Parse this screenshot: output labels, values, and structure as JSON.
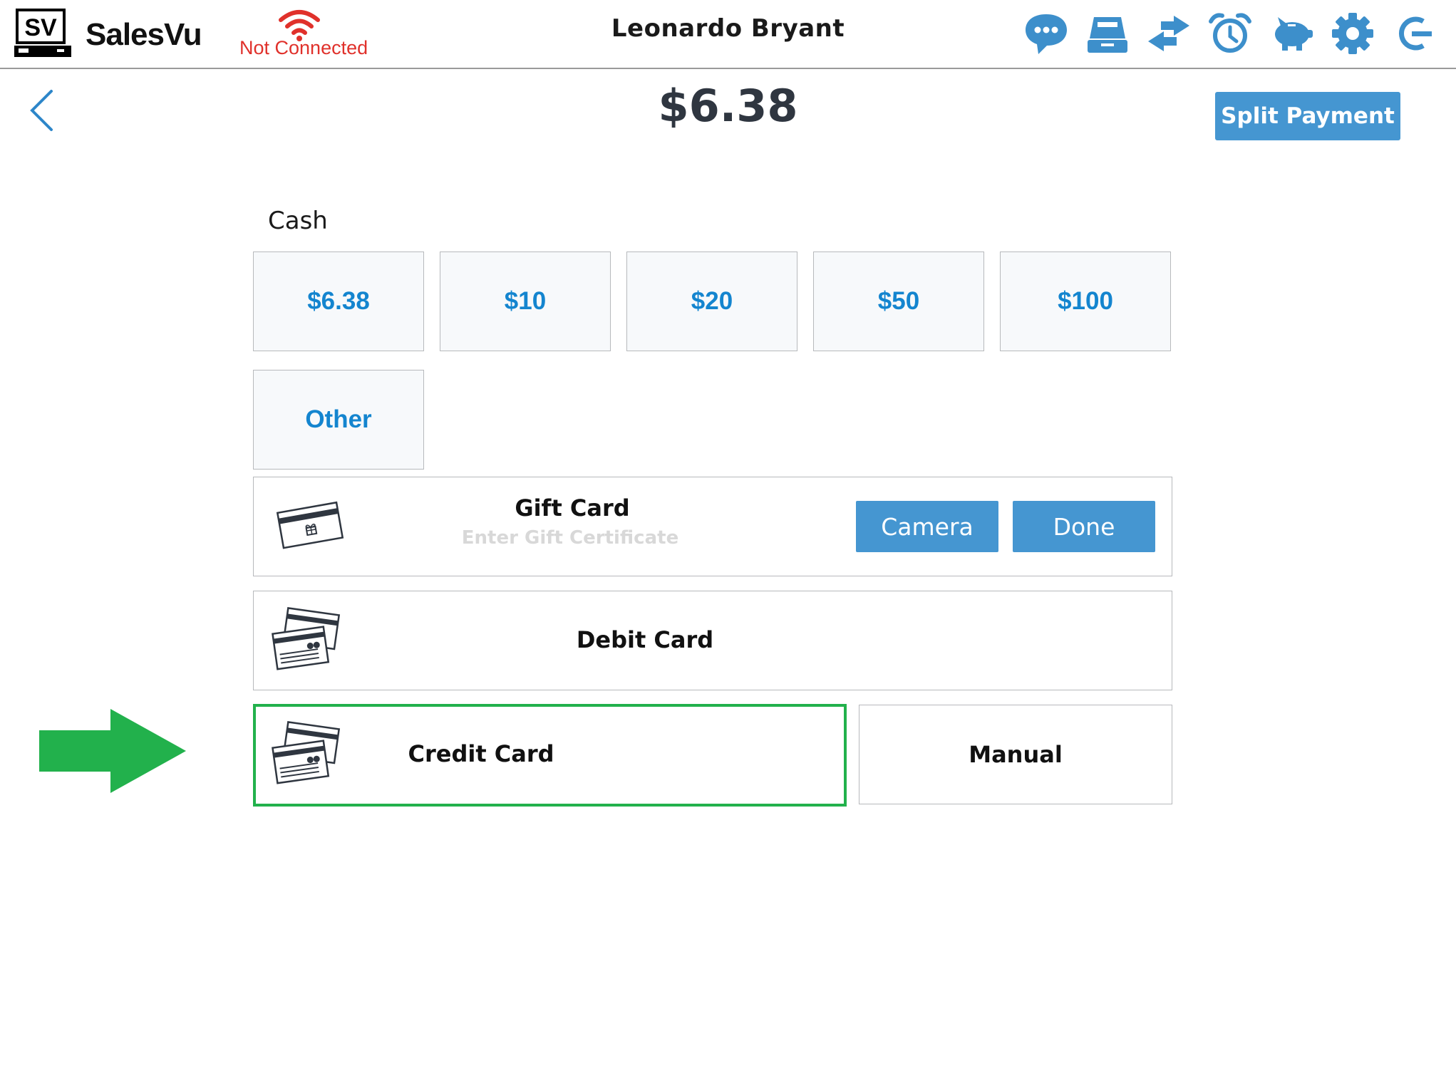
{
  "header": {
    "brand": "SalesVu",
    "logo_text": "SV",
    "connection_status": "Not Connected",
    "user_name": "Leonardo Bryant",
    "icons": [
      "chat-icon",
      "register-icon",
      "transfer-icon",
      "alarm-icon",
      "piggy-bank-icon",
      "settings-icon",
      "logout-icon"
    ]
  },
  "payment": {
    "amount": "$6.38",
    "split_label": "Split Payment"
  },
  "cash": {
    "label": "Cash",
    "options": [
      "$6.38",
      "$10",
      "$20",
      "$50",
      "$100"
    ],
    "other_label": "Other"
  },
  "gift_card": {
    "label": "Gift Card",
    "placeholder": "Enter Gift Certificate",
    "camera_label": "Camera",
    "done_label": "Done"
  },
  "debit_card": {
    "label": "Debit Card"
  },
  "credit_card": {
    "label": "Credit Card",
    "manual_label": "Manual"
  },
  "colors": {
    "accent": "#4596d1",
    "cash_text": "#1485cf",
    "not_connected": "#e0312b",
    "highlight": "#22b14c"
  }
}
